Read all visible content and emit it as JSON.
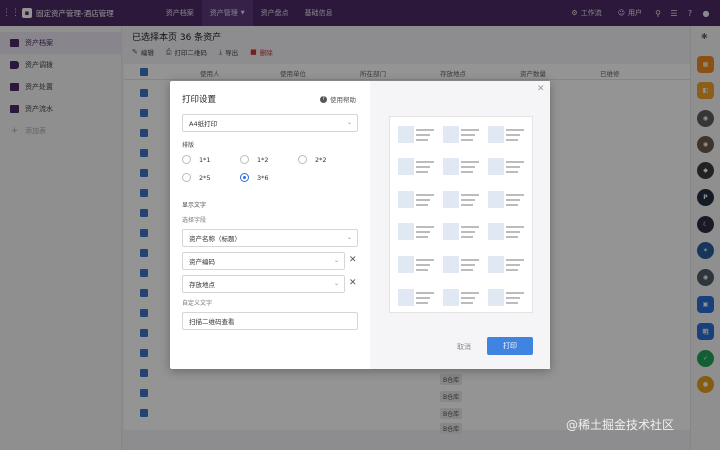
{
  "topbar": {
    "app_title": "固定资产管理-酒店管理",
    "nav": [
      "资产档案",
      "资产管理",
      "资产盘点",
      "基础信息"
    ],
    "workbench": "工作流",
    "user": "用户"
  },
  "sidebar": {
    "items": [
      {
        "label": "资产档案"
      },
      {
        "label": "资产调拨"
      },
      {
        "label": "资产处置"
      },
      {
        "label": "资产流水"
      }
    ],
    "add_label": "添加表"
  },
  "main": {
    "title": "已选择本页 36 条资产",
    "toolbar": {
      "edit": "编辑",
      "print_qr": "打印二维码",
      "export": "导出",
      "delete": "删除"
    },
    "columns": [
      "使用人",
      "使用单位",
      "所在部门",
      "存放地点",
      "资产数量",
      "已维修"
    ],
    "location_tags": [
      "B仓库",
      "B仓库",
      "B仓库",
      "B仓库"
    ]
  },
  "dialog": {
    "title": "打印设置",
    "help": "使用帮助",
    "paper_select": "A4纸打印",
    "layout_label": "排版",
    "layout_options": [
      "1*1",
      "1*2",
      "2*2",
      "2*5",
      "3*6"
    ],
    "layout_selected": "3*6",
    "display_text_label": "显示文字",
    "select_fields_label": "选择字段",
    "field_1": "资产名称（标题）",
    "field_2": "资产编码",
    "field_3": "存放地点",
    "custom_text_label": "自定义文字",
    "custom_text_value": "扫描二维码查看",
    "cancel": "取消",
    "print": "打印"
  },
  "watermark": "@稀土掘金技术社区",
  "colors": {
    "topbar": "#4b2a66",
    "primary": "#3f84e0",
    "checkbox": "#3a76c4"
  }
}
